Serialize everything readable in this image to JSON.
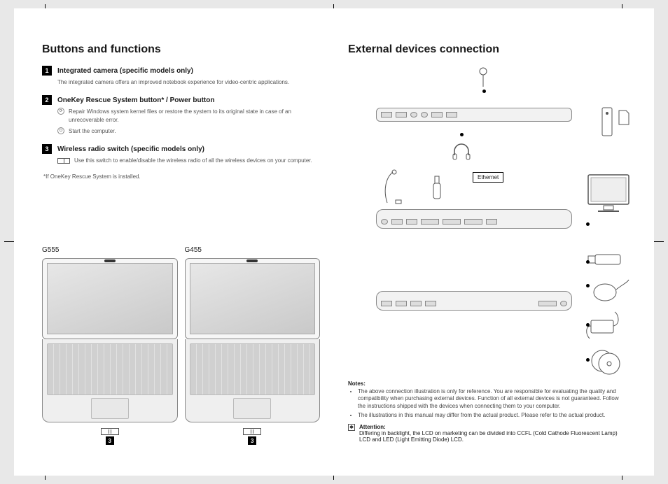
{
  "left": {
    "heading": "Buttons and functions",
    "items": [
      {
        "num": "1",
        "title": "Integrated camera (specific models only)",
        "lines": [
          {
            "icon": null,
            "text": "The integrated camera offers an improved notebook experience for video-centric applications."
          }
        ]
      },
      {
        "num": "2",
        "title": "OneKey Rescue System button* / Power button",
        "lines": [
          {
            "icon": "ring",
            "text": "Repair Windows system kernel files or restore the system to its original state in case of an unrecoverable error."
          },
          {
            "icon": "power",
            "text": "Start the computer."
          }
        ]
      },
      {
        "num": "3",
        "title": "Wireless radio switch (specific models only)",
        "lines": [
          {
            "icon": "switch",
            "text": "Use this switch to enable/disable the wireless radio of all the wireless devices on your computer."
          }
        ]
      }
    ],
    "footnote": "*If OneKey Rescue System is installed.",
    "model_a": "G555",
    "model_b": "G455",
    "under_num": "3"
  },
  "right": {
    "heading": "External devices connection",
    "ethernet_label": "Ethernet",
    "notes_heading": "Notes:",
    "notes": [
      "The above connection illustration is only for reference. You are responsible for evaluating the quality and compatibility when purchasing external devices. Function of all external devices is not guaranteed. Follow the instructions shipped with the devices when connecting them to your computer.",
      "The illustrations in this manual may differ from the actual product. Please refer to the actual product."
    ],
    "attention_heading": "Attention:",
    "attention_text": "Differing in backlight, the LCD on marketing can be divided into CCFL (Cold Cathode Fluorescent Lamp) LCD and LED (Light Emitting Diode) LCD."
  }
}
